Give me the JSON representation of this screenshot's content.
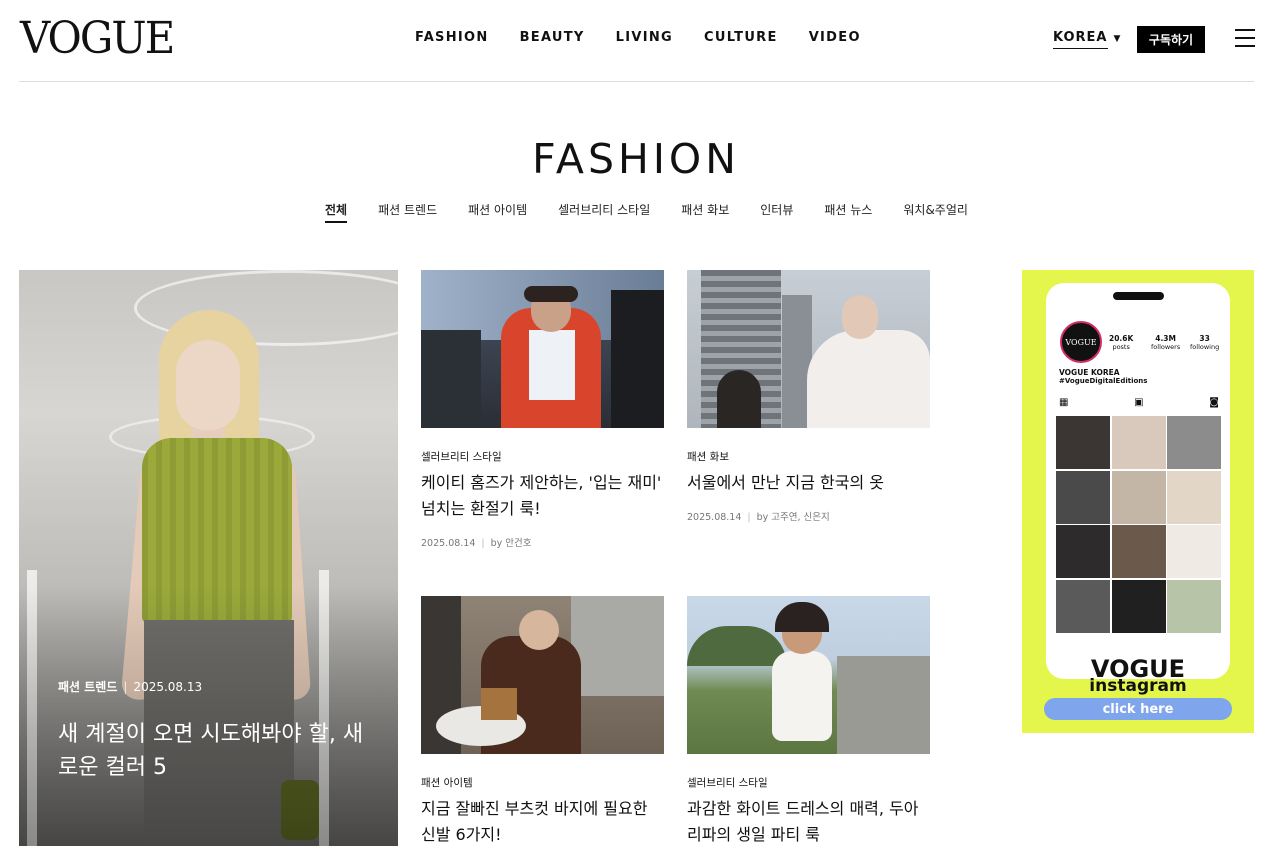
{
  "header": {
    "logo": "VOGUE",
    "nav": [
      "FASHION",
      "BEAUTY",
      "LIVING",
      "CULTURE",
      "VIDEO"
    ],
    "edition": "KOREA",
    "subscribe_label": "구독하기"
  },
  "section": {
    "title": "FASHION",
    "tabs": [
      "전체",
      "패션 트렌드",
      "패션 아이템",
      "셀러브리티 스타일",
      "패션 화보",
      "인터뷰",
      "패션 뉴스",
      "워치&주얼리"
    ],
    "active_tab": "전체"
  },
  "hero": {
    "category": "패션 트렌드",
    "date": "2025.08.13",
    "title": "새 계절이 오면 시도해봐야 할, 새로운 컬러 5"
  },
  "articles": [
    {
      "category": "셀러브리티 스타일",
      "title": "케이티 홈즈가 제안하는, '입는 재미' 넘치는 환절기 룩!",
      "date": "2025.08.14",
      "byline": "by 안건호"
    },
    {
      "category": "패션 화보",
      "title": "서울에서 만난 지금 한국의 옷",
      "date": "2025.08.14",
      "byline": "by 고주연, 신은지"
    },
    {
      "category": "패션 아이템",
      "title": "지금 잘빠진 부츠컷 바지에 필요한 신발 6가지!",
      "date": "",
      "byline": ""
    },
    {
      "category": "셀러브리티 스타일",
      "title": "과감한 화이트 드레스의 매력, 두아 리파의 생일 파티 룩",
      "date": "",
      "byline": ""
    }
  ],
  "ad": {
    "avatar_text": "VOGUE",
    "stats": [
      {
        "value": "20.6K",
        "label": "posts"
      },
      {
        "value": "4.3M",
        "label": "followers"
      },
      {
        "value": "33",
        "label": "following"
      }
    ],
    "account_name": "VOGUE KOREA",
    "hashtag": "#VogueDigitalEditions",
    "headline": "VOGUE",
    "subheadline": "instagram",
    "cta": "click here"
  },
  "colors": {
    "ad_background": "#e4f54b",
    "cta_button": "#7fa5ec",
    "subscribe_button": "#000000"
  },
  "icons": [
    "hamburger-menu-icon",
    "caret-down-icon",
    "grid-icon",
    "reels-icon",
    "tagged-icon"
  ]
}
